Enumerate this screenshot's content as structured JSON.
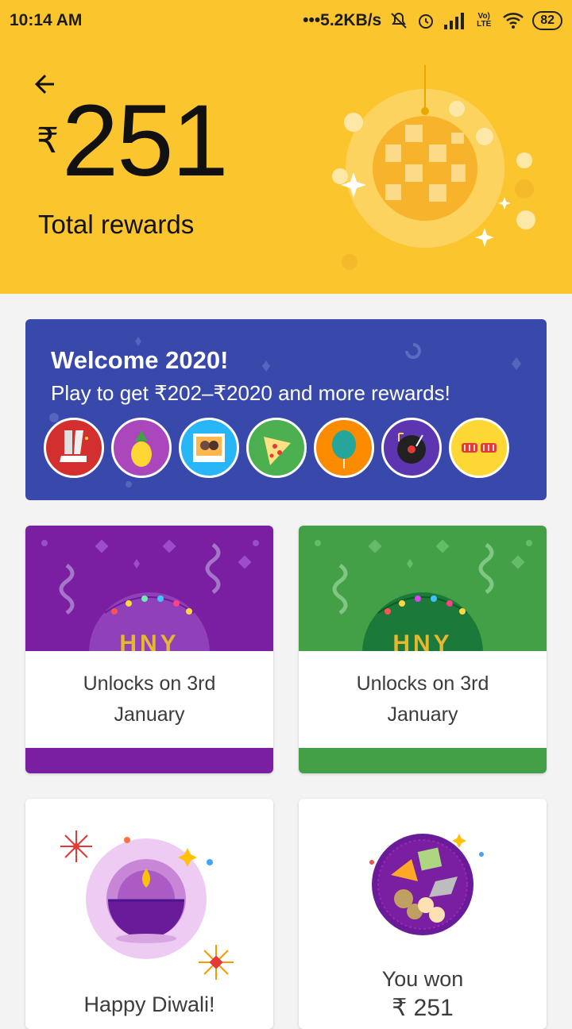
{
  "status": {
    "time": "10:14 AM",
    "speed": "•••5.2KB/s",
    "battery": "82",
    "lte": "Vo) LTE"
  },
  "header": {
    "rupee_symbol": "₹",
    "amount": "251",
    "label": "Total rewards",
    "bg_color": "#fbc52d"
  },
  "welcome": {
    "title": "Welcome 2020!",
    "subtitle": "Play to get ₹202–₹2020 and more rewards!",
    "bg_color": "#3949ab",
    "stickers": [
      "dance-shoes-icon",
      "pineapple-icon",
      "photo-icon",
      "pizza-icon",
      "balloon-icon",
      "record-icon",
      "party-glasses-icon"
    ]
  },
  "cards": [
    {
      "line1": "Unlocks on 3rd",
      "line2": "January",
      "color": "#7b1fa2",
      "art_text": "HNY"
    },
    {
      "line1": "Unlocks on 3rd",
      "line2": "January",
      "color": "#43a047",
      "art_text": "HNY"
    },
    {
      "title": "Happy Diwali!"
    },
    {
      "line1": "You won",
      "amount": "₹ 251"
    }
  ]
}
